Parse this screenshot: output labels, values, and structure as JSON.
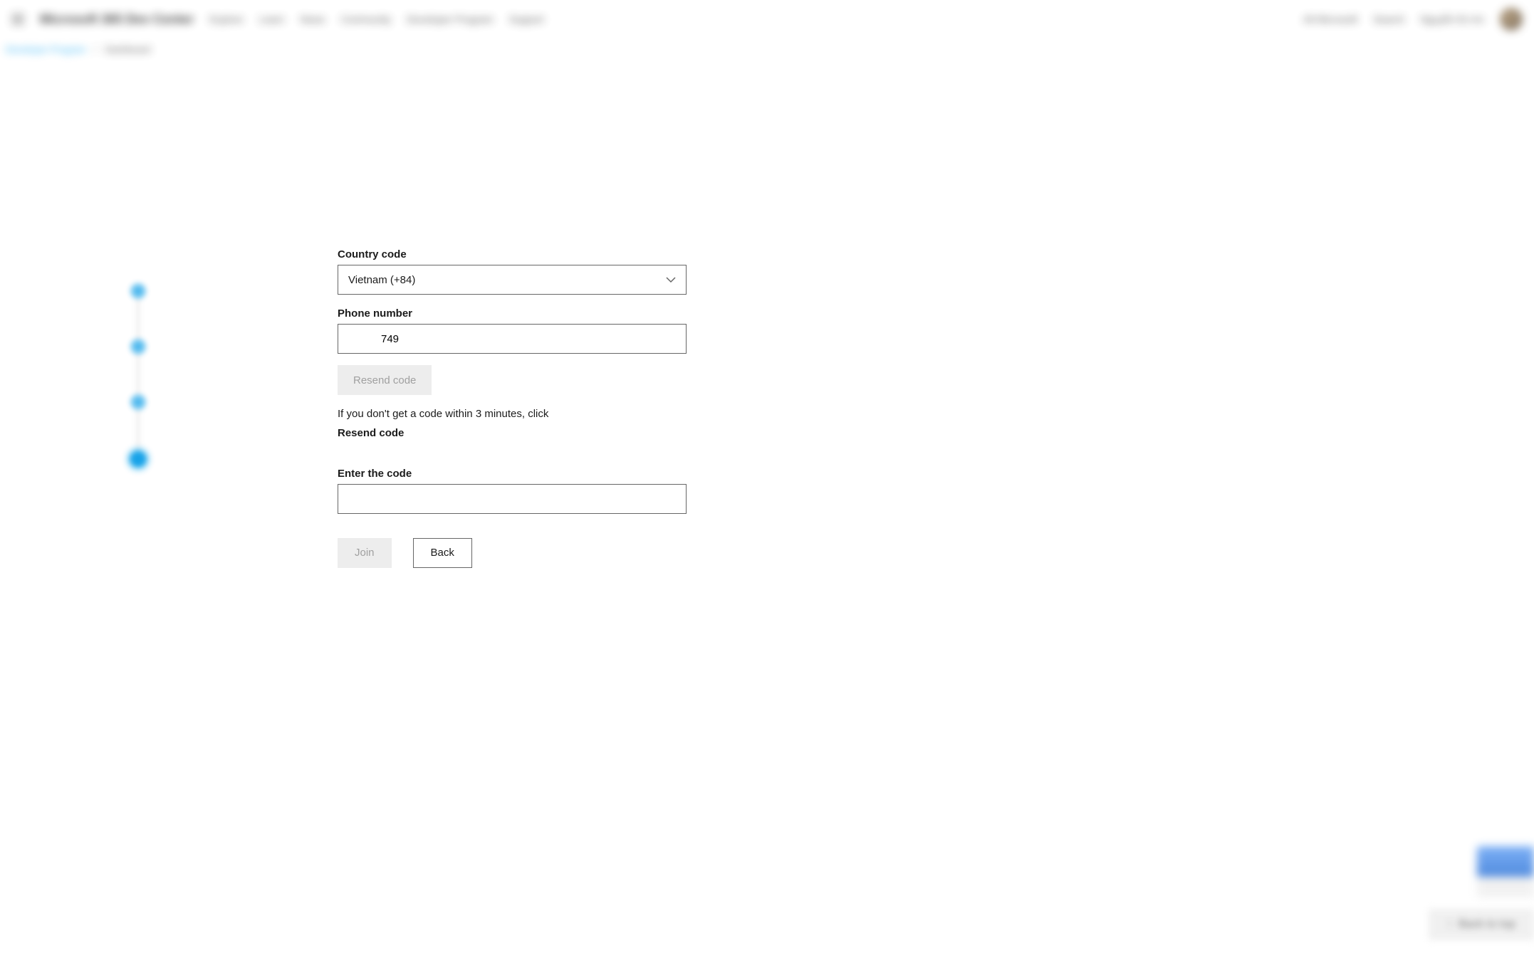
{
  "header": {
    "brand": "Microsoft 365 Dev Center",
    "nav": [
      "Explore",
      "Learn",
      "News",
      "Community",
      "Developer Program",
      "Support"
    ],
    "right": {
      "all": "All Microsoft",
      "search": "Search",
      "user": "Nguyễn En An"
    }
  },
  "breadcrumb": {
    "link": "Developer Program",
    "current": "Dashboard"
  },
  "form": {
    "country_label": "Country code",
    "country_value": "Vietnam (+84)",
    "phone_label": "Phone number",
    "phone_value": "749",
    "resend_button": "Resend code",
    "info_text": "If you don't get a code within 3 minutes, click",
    "info_bold": "Resend code",
    "code_label": "Enter the code",
    "code_value": "",
    "join_button": "Join",
    "back_button": "Back"
  },
  "footer": {
    "back_to_top": "Back to top"
  }
}
